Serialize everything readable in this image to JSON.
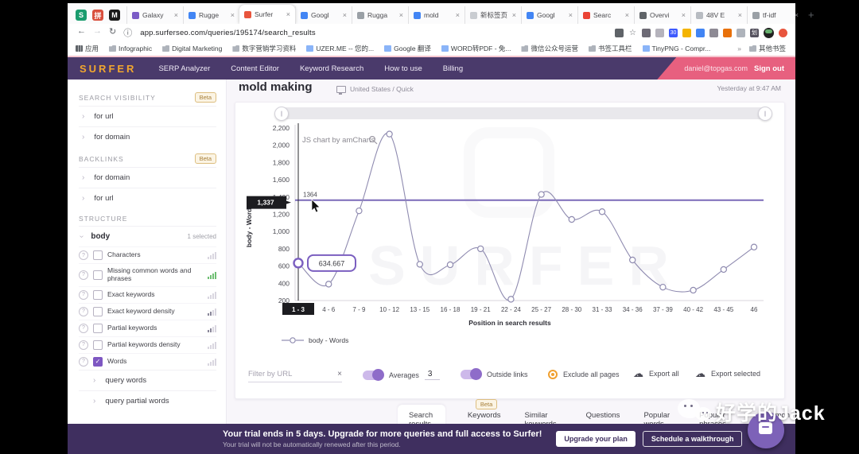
{
  "browser": {
    "pinned_tabs": [
      {
        "name": "pinned-tab-s",
        "glyph": "S",
        "color": "#1a9c6e"
      },
      {
        "name": "pinned-tab-grid",
        "glyph": "拼",
        "color": "#d94f3d"
      },
      {
        "name": "pinned-tab-m",
        "glyph": "M",
        "color": "#1a1a1a"
      }
    ],
    "tabs": [
      {
        "label": "Galaxy",
        "icon_color": "#7b5cc6",
        "active": false
      },
      {
        "label": "Rugge",
        "icon_color": "#4285f4",
        "active": false
      },
      {
        "label": "Surfer",
        "icon_color": "#e8553d",
        "active": true
      },
      {
        "label": "Googl",
        "icon_color": "#4285f4",
        "active": false
      },
      {
        "label": "Rugga",
        "icon_color": "#9aa0a6",
        "active": false
      },
      {
        "label": "mold",
        "icon_color": "#4285f4",
        "active": false
      },
      {
        "label": "新标签页",
        "icon_color": "#c9ccd1",
        "active": false
      },
      {
        "label": "Googl",
        "icon_color": "#4285f4",
        "active": false
      },
      {
        "label": "Searc",
        "icon_color": "#ea4335",
        "active": false
      },
      {
        "label": "Overvi",
        "icon_color": "#5f6368",
        "active": false
      },
      {
        "label": "48V E",
        "icon_color": "#b8bcc2",
        "active": false
      },
      {
        "label": "tf-idf",
        "icon_color": "#9aa0a6",
        "active": false
      }
    ],
    "close_glyph": "×",
    "new_tab_glyph": "+",
    "nav": {
      "back": "←",
      "forward": "→",
      "reload": "↻",
      "info": "ⓘ"
    },
    "url": "app.surferseo.com/queries/195174/search_results",
    "addr_icons": [
      {
        "name": "translate-icon",
        "color": "#5f6368",
        "glyph": ""
      },
      {
        "name": "star-icon",
        "color": "transparent",
        "glyph": "☆"
      },
      {
        "name": "ext-pointer-icon",
        "color": "#6d6a75",
        "glyph": ""
      },
      {
        "name": "ext-gray-icon",
        "color": "#b5b3bc",
        "glyph": ""
      },
      {
        "name": "ext-30-icon",
        "color": "#3d5afe",
        "glyph": "30"
      },
      {
        "name": "ext-yellow-icon",
        "color": "#f4b400",
        "glyph": ""
      },
      {
        "name": "ext-blue-icon",
        "color": "#4285f4",
        "glyph": ""
      },
      {
        "name": "ext-gear-icon",
        "color": "#8d8a94",
        "glyph": ""
      },
      {
        "name": "ext-orange-icon",
        "color": "#e8710a",
        "glyph": ""
      },
      {
        "name": "ext-doc-icon",
        "color": "#aeb3bb",
        "glyph": ""
      },
      {
        "name": "ext-xh-icon",
        "color": "#55525e",
        "glyph": "划"
      }
    ],
    "menu_dot_color": "#e8553d",
    "bookmarks": [
      {
        "label": "应用",
        "type": "grid"
      },
      {
        "label": "Infographic",
        "type": "folder"
      },
      {
        "label": "Digital Marketing",
        "type": "folder"
      },
      {
        "label": "数字营销学习资料",
        "type": "folder"
      },
      {
        "label": "UZER.ME -- 您的...",
        "type": "site"
      },
      {
        "label": "Google 翻译",
        "type": "site"
      },
      {
        "label": "WORD转PDF - 免...",
        "type": "site"
      },
      {
        "label": "微信公众号运营",
        "type": "folder"
      },
      {
        "label": "书签工具栏",
        "type": "folder"
      },
      {
        "label": "TinyPNG - Compr...",
        "type": "site"
      }
    ],
    "bookmarks_overflow": "»",
    "other_bookmarks": {
      "label": "其他书签",
      "type": "folder"
    }
  },
  "app": {
    "logo": "SURFER",
    "nav": [
      "SERP Analyzer",
      "Content Editor",
      "Keyword Research",
      "How to use",
      "Billing"
    ],
    "account_email": "daniel@topgas.com",
    "sign_out": "Sign out",
    "query_title": "mold making",
    "query_meta": "United States / Quick",
    "timestamp": "Yesterday at 9:47 AM"
  },
  "sidebar": {
    "beta_label": "Beta",
    "groups": [
      {
        "title": "SEARCH VISIBILITY",
        "beta": true,
        "items": [
          "for url",
          "for domain"
        ]
      },
      {
        "title": "BACKLINKS",
        "beta": true,
        "items": [
          "for domain",
          "for url"
        ]
      }
    ],
    "structure_title": "STRUCTURE",
    "body_label": "body",
    "body_note": "1 selected",
    "metrics": [
      {
        "label": "Characters",
        "checked": false,
        "bars": "gray"
      },
      {
        "label": "Missing common words and phrases",
        "checked": false,
        "bars": "green"
      },
      {
        "label": "Exact keywords",
        "checked": false,
        "bars": "gray"
      },
      {
        "label": "Exact keyword density",
        "checked": false,
        "bars": "dark"
      },
      {
        "label": "Partial keywords",
        "checked": false,
        "bars": "dark"
      },
      {
        "label": "Partial keywords density",
        "checked": false,
        "bars": "gray"
      },
      {
        "label": "Words",
        "checked": true,
        "bars": "gray"
      }
    ],
    "subitems": [
      "query words",
      "query partial words"
    ],
    "check_glyph": "✓",
    "chevron_glyph": "›"
  },
  "chart_data": {
    "type": "line",
    "title": "",
    "categories": [
      "1 - 3",
      "4 - 6",
      "7 - 9",
      "10 - 12",
      "13 - 15",
      "16 - 18",
      "19 - 21",
      "22 - 24",
      "25 - 27",
      "28 - 30",
      "31 - 33",
      "34 - 36",
      "37 - 39",
      "40 - 42",
      "43 - 45",
      "46"
    ],
    "series": [
      {
        "name": "body - Words",
        "values": [
          634.667,
          390,
          1240,
          2130,
          620,
          615,
          800,
          215,
          1430,
          1140,
          1230,
          670,
          355,
          320,
          560,
          820
        ]
      }
    ],
    "ylabel": "body - Words",
    "xlabel": "Position in search results",
    "ylim": [
      200,
      2200
    ],
    "ytick_step": 200,
    "grid": false,
    "legend_position": "bottom-left",
    "average_line": {
      "value": 1364,
      "label": "1364",
      "color": "#7a6ab8"
    },
    "cursor": {
      "category_index": 0,
      "x_box_label": "1 - 3",
      "y_box_label": "1,337",
      "tooltip": "634.667"
    },
    "credit": "JS chart by amCharts",
    "watermark": "SURFER",
    "line_color": "#8f8bb0",
    "marker_highlight_color": "#7b5fc0"
  },
  "controls": {
    "filter_placeholder": "Filter by URL",
    "clear_glyph": "×",
    "averages_label": "Averages",
    "averages_value": "3",
    "outside_links_label": "Outside links",
    "exclude_label": "Exclude all pages",
    "export_all_label": "Export all",
    "export_selected_label": "Export selected",
    "cloud_glyph": "☁",
    "down_glyph": "↓"
  },
  "bottom_tabs": {
    "beta_label": "Beta",
    "items": [
      {
        "label": "Search results",
        "active": true,
        "beta": false
      },
      {
        "label": "Keywords",
        "active": false,
        "beta": true
      },
      {
        "label": "Similar keywords",
        "active": false,
        "beta": false
      },
      {
        "label": "Questions",
        "active": false,
        "beta": false
      },
      {
        "label": "Popular words",
        "active": false,
        "beta": false
      },
      {
        "label": "Popular phrases",
        "active": false,
        "beta": false
      },
      {
        "label": "Common words",
        "active": false,
        "beta": false
      }
    ]
  },
  "banner": {
    "title": "Your trial ends in 5 days. Upgrade for more queries and full access to Surfer!",
    "subtitle": "Your trial will not be automatically renewed after this period.",
    "upgrade_button": "Upgrade your plan",
    "walkthrough_button": "Schedule a walkthrough"
  },
  "watermark_text": "好学的Jack"
}
